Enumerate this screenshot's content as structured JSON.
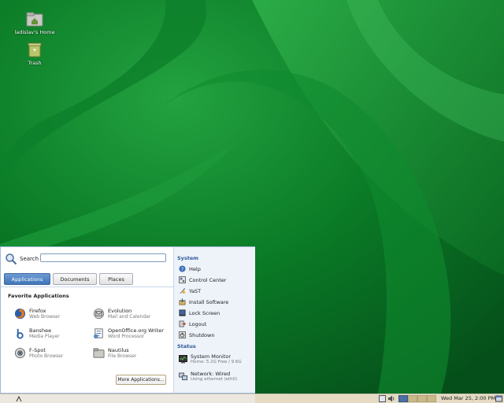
{
  "desktop": {
    "icons": [
      {
        "label": "ladislav's Home",
        "icon": "home-folder-icon"
      },
      {
        "label": "Trash",
        "icon": "trash-icon"
      }
    ]
  },
  "menu": {
    "search": {
      "label": "Search",
      "value": "",
      "icon": "search-icon"
    },
    "tabs": [
      {
        "label": "Applications",
        "active": true
      },
      {
        "label": "Documents",
        "active": false
      },
      {
        "label": "Places",
        "active": false
      }
    ],
    "favorites": {
      "heading": "Favorite Applications",
      "apps": [
        {
          "name": "Firefox",
          "desc": "Web Browser",
          "icon": "firefox-icon"
        },
        {
          "name": "Evolution",
          "desc": "Mail and Calendar",
          "icon": "evolution-icon"
        },
        {
          "name": "Banshee",
          "desc": "Media Player",
          "icon": "banshee-icon"
        },
        {
          "name": "OpenOffice.org Writer",
          "desc": "Word Processor",
          "icon": "writer-icon"
        },
        {
          "name": "F-Spot",
          "desc": "Photo Browser",
          "icon": "fspot-icon"
        },
        {
          "name": "Nautilus",
          "desc": "File Browser",
          "icon": "nautilus-icon"
        }
      ]
    },
    "more_button": "More Applications...",
    "system": {
      "heading": "System",
      "items": [
        {
          "label": "Help",
          "icon": "help-icon"
        },
        {
          "label": "Control Center",
          "icon": "control-center-icon"
        },
        {
          "label": "YaST",
          "icon": "yast-icon"
        },
        {
          "label": "Install Software",
          "icon": "install-software-icon"
        },
        {
          "label": "Lock Screen",
          "icon": "lock-screen-icon"
        },
        {
          "label": "Logout",
          "icon": "logout-icon"
        },
        {
          "label": "Shutdown",
          "icon": "shutdown-icon"
        }
      ]
    },
    "status": {
      "heading": "Status",
      "items": [
        {
          "label": "System Monitor",
          "sub": "Home: 5.2G Free / 9.6G",
          "icon": "system-monitor-icon"
        },
        {
          "label": "Network: Wired",
          "sub": "Using ethernet (eth0)",
          "icon": "network-icon"
        }
      ]
    }
  },
  "taskbar": {
    "clock": "Wed Mar 25,  2:00 PM",
    "tray_icons": [
      "network-tray-icon",
      "updates-tray-icon",
      "volume-icon"
    ],
    "workspaces": 4,
    "active_workspace": 1,
    "show_desktop_icon": "show-desktop-icon"
  },
  "colors": {
    "accent": "#3f74b9",
    "wallpaper": "#0a6a1f",
    "section_heading": "#2d5b96"
  }
}
